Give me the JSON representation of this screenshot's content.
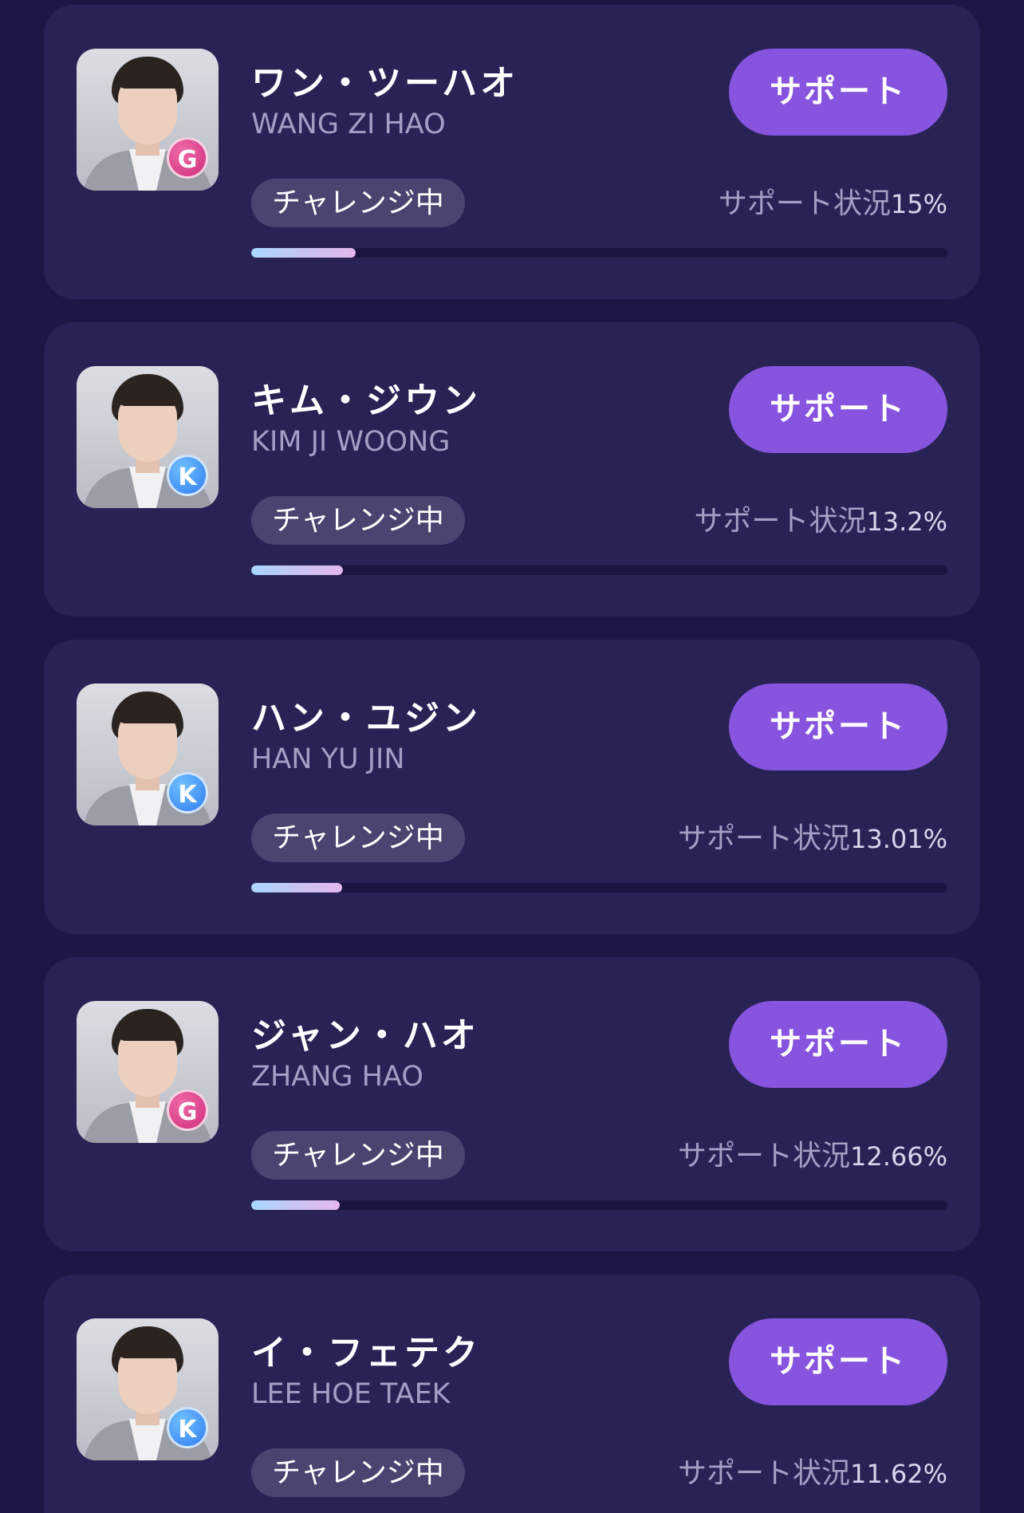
{
  "status_label": "チャレンジ中",
  "support_status_label": "サポート状況",
  "colors": {
    "background": "#1d1745",
    "card": "#292355",
    "button": "#8654de",
    "badge_G": "#d63b86",
    "badge_K": "#3d8ff5"
  },
  "candidates": [
    {
      "name_jp": "ワン・ツーハオ",
      "name_en": "WANG ZI HAO",
      "group": "G",
      "button_label": "サポート",
      "support_percent": "15%",
      "progress_fraction": 0.15
    },
    {
      "name_jp": "キム・ジウン",
      "name_en": "KIM JI WOONG",
      "group": "K",
      "button_label": "サポート",
      "support_percent": "13.2%",
      "progress_fraction": 0.132
    },
    {
      "name_jp": "ハン・ユジン",
      "name_en": "HAN YU JIN",
      "group": "K",
      "button_label": "サポート",
      "support_percent": "13.01%",
      "progress_fraction": 0.1301
    },
    {
      "name_jp": "ジャン・ハオ",
      "name_en": "ZHANG HAO",
      "group": "G",
      "button_label": "サポート",
      "support_percent": "12.66%",
      "progress_fraction": 0.1266
    },
    {
      "name_jp": "イ・フェテク",
      "name_en": "LEE HOE TAEK",
      "group": "K",
      "button_label": "サポート",
      "support_percent": "11.62%",
      "progress_fraction": 0.1162
    }
  ]
}
